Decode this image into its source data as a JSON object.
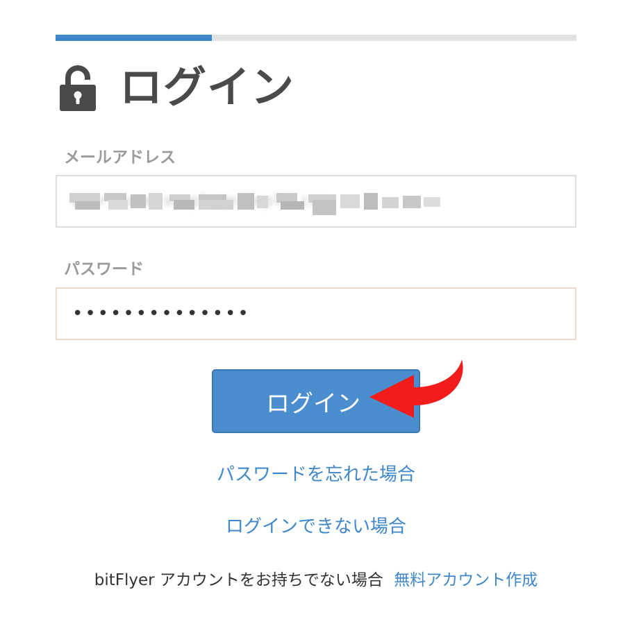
{
  "progress": {
    "percent": 30,
    "fill_color": "#3e87c9",
    "track_color": "#e2e2e2"
  },
  "header": {
    "icon": "lock-icon",
    "title": "ログイン"
  },
  "form": {
    "email_label": "メールアドレス",
    "email_value": "user.name.sample@example.com",
    "password_label": "パスワード",
    "password_value": "••••••••••••••"
  },
  "actions": {
    "login_label": "ログイン",
    "button_color": "#4a8ecf",
    "arrow_icon": "red-curved-arrow-icon",
    "arrow_color": "#f21c1c"
  },
  "links": {
    "forgot_password": "パスワードを忘れた場合",
    "cannot_login": "ログインできない場合"
  },
  "signup": {
    "prompt": "bitFlyer アカウントをお持ちでない場合",
    "link": "無料アカウント作成"
  }
}
